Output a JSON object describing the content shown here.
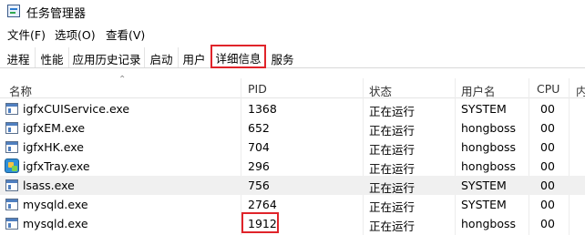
{
  "window": {
    "title": "任务管理器"
  },
  "menu": {
    "items": [
      "文件(F)",
      "选项(O)",
      "查看(V)"
    ]
  },
  "tabs": [
    "进程",
    "性能",
    "应用历史记录",
    "启动",
    "用户",
    "详细信息",
    "服务"
  ],
  "active_tab": "详细信息",
  "columns": [
    "名称",
    "PID",
    "状态",
    "用户名",
    "CPU",
    "内"
  ],
  "rows": [
    {
      "name": "igfxCUIService.exe",
      "pid": "1368",
      "status": "正在运行",
      "user": "SYSTEM",
      "cpu": "00",
      "icon": "process-icon"
    },
    {
      "name": "igfxEM.exe",
      "pid": "652",
      "status": "正在运行",
      "user": "hongboss",
      "cpu": "00",
      "icon": "process-icon"
    },
    {
      "name": "igfxHK.exe",
      "pid": "704",
      "status": "正在运行",
      "user": "hongboss",
      "cpu": "00",
      "icon": "process-icon"
    },
    {
      "name": "igfxTray.exe",
      "pid": "296",
      "status": "正在运行",
      "user": "hongboss",
      "cpu": "00",
      "icon": "tray-app-icon"
    },
    {
      "name": "lsass.exe",
      "pid": "756",
      "status": "正在运行",
      "user": "SYSTEM",
      "cpu": "00",
      "icon": "process-icon"
    },
    {
      "name": "mysqld.exe",
      "pid": "2764",
      "status": "正在运行",
      "user": "SYSTEM",
      "cpu": "00",
      "icon": "process-icon"
    },
    {
      "name": "mysqld.exe",
      "pid": "1912",
      "status": "正在运行",
      "user": "hongboss",
      "cpu": "00",
      "icon": "process-icon"
    }
  ],
  "highlight_color": "#e0242a"
}
